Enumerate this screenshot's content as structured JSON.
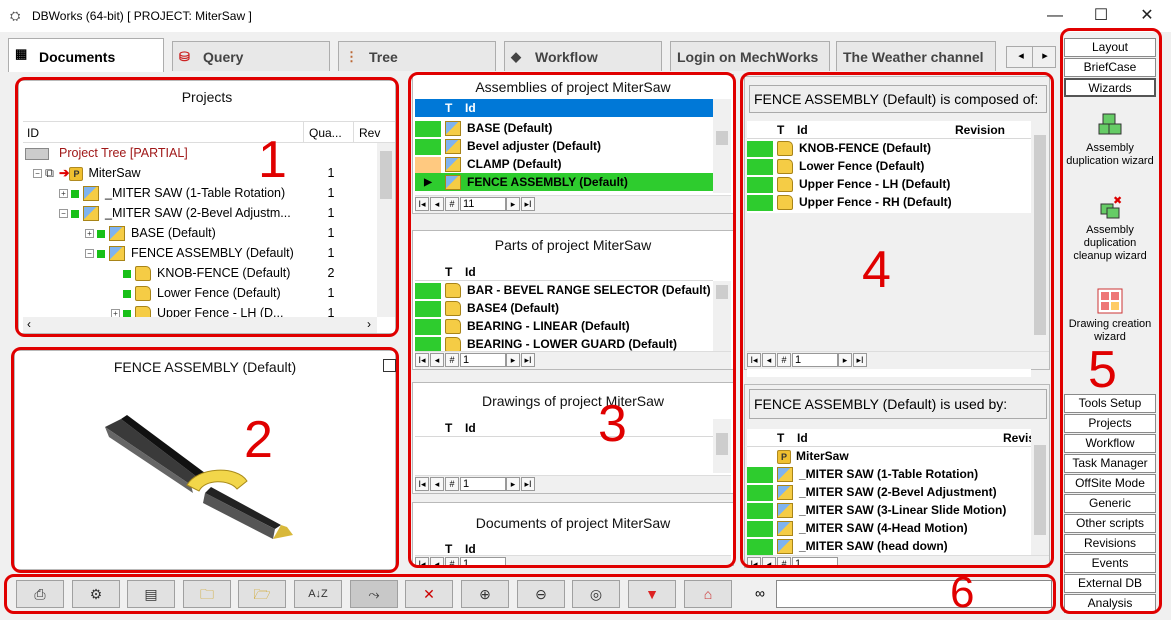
{
  "window": {
    "title": "DBWorks (64-bit) [ PROJECT: MiterSaw ]",
    "minimize": "—",
    "maximize": "☐",
    "close": "✕"
  },
  "tabs": [
    {
      "label": "Documents",
      "icon": "documents-icon"
    },
    {
      "label": "Query",
      "icon": "database-icon"
    },
    {
      "label": "Tree",
      "icon": "tree-icon"
    },
    {
      "label": "Workflow",
      "icon": "workflow-icon"
    },
    {
      "label": "Login on MechWorks"
    },
    {
      "label": "The Weather channel"
    }
  ],
  "tab_scroll": {
    "left": "◂",
    "right": "▸"
  },
  "projects_panel": {
    "title": "Projects",
    "columns": [
      "ID",
      "Qua...",
      "Rev"
    ],
    "rows": [
      {
        "label": "Project Tree [PARTIAL]",
        "qty": ""
      },
      {
        "label": "MiterSaw",
        "qty": "1"
      },
      {
        "label": "_MITER SAW (1-Table Rotation)",
        "qty": "1"
      },
      {
        "label": "_MITER SAW (2-Bevel Adjustm...",
        "qty": "1"
      },
      {
        "label": "BASE (Default)",
        "qty": "1"
      },
      {
        "label": "FENCE ASSEMBLY (Default)",
        "qty": "1"
      },
      {
        "label": "KNOB-FENCE (Default)",
        "qty": "2"
      },
      {
        "label": "Lower Fence (Default)",
        "qty": "1"
      },
      {
        "label": "Upper Fence - LH (D...",
        "qty": "1"
      }
    ]
  },
  "preview_panel": {
    "title": "FENCE ASSEMBLY (Default)"
  },
  "assemblies_panel": {
    "title": "Assemblies of project MiterSaw",
    "col_t": "T",
    "col_id": "Id",
    "rows": [
      "BASE (Default)",
      "Bevel adjuster (Default)",
      "CLAMP (Default)",
      "FENCE ASSEMBLY (Default)"
    ],
    "nav_value": "11"
  },
  "parts_panel": {
    "title": "Parts of project MiterSaw",
    "col_t": "T",
    "col_id": "Id",
    "rows": [
      "BAR - BEVEL RANGE SELECTOR (Default)",
      "BASE4 (Default)",
      "BEARING - LINEAR (Default)",
      "BEARING - LOWER GUARD (Default)"
    ],
    "nav_value": "1"
  },
  "drawings_panel": {
    "title": "Drawings of project MiterSaw",
    "col_t": "T",
    "col_id": "Id",
    "nav_value": "1"
  },
  "documents_panel": {
    "title": "Documents of project MiterSaw",
    "col_t": "T",
    "col_id": "Id",
    "nav_value": "1"
  },
  "composed_panel": {
    "title": "FENCE ASSEMBLY (Default) is composed of:",
    "col_t": "T",
    "col_id": "Id",
    "col_rev": "Revision",
    "rows": [
      "KNOB-FENCE (Default)",
      "Lower Fence (Default)",
      "Upper Fence - LH (Default)",
      "Upper Fence - RH (Default)"
    ],
    "nav_value": "1"
  },
  "usedby_panel": {
    "title": "FENCE ASSEMBLY (Default) is used by:",
    "col_t": "T",
    "col_id": "Id",
    "col_rev": "Revis",
    "rows": [
      "MiterSaw",
      "_MITER SAW (1-Table Rotation)",
      "_MITER SAW (2-Bevel Adjustment)",
      "_MITER SAW (3-Linear Slide Motion)",
      "_MITER SAW (4-Head Motion)",
      "_MITER SAW (head down)"
    ],
    "nav_value": "1"
  },
  "sidebar": {
    "top_buttons": [
      "Layout",
      "BriefCase",
      "Wizards"
    ],
    "wizards": [
      {
        "label": "Assembly duplication wizard",
        "icon": "assembly-duplication-icon"
      },
      {
        "label": "Assembly duplication cleanup wizard",
        "icon": "assembly-cleanup-icon"
      },
      {
        "label": "Drawing creation wizard",
        "icon": "drawing-creation-icon"
      }
    ],
    "bottom_buttons": [
      "Tools Setup",
      "Projects",
      "Workflow",
      "Task Manager",
      "OffSite Mode",
      "Generic",
      "Other scripts",
      "Revisions",
      "Events",
      "External DB",
      "Analysis"
    ]
  },
  "toolbar": {
    "icons": [
      "print-icon",
      "print-settings-icon",
      "window-icon",
      "folder-add-icon",
      "folder-icon",
      "sort-az-icon",
      "flow-icon",
      "delete-document-icon",
      "zoom-in-icon",
      "zoom-out-icon",
      "zoom-100-icon",
      "filter-icon",
      "home-icon",
      "binoculars-icon"
    ],
    "search_value": ""
  },
  "annotations": [
    "1",
    "2",
    "3",
    "4",
    "5",
    "6"
  ],
  "colors": {
    "highlight_red": "#e00000",
    "status_green": "#2ecc2e",
    "selection_blue": "#0078d7",
    "selected_row_green": "#2ecc2e"
  }
}
